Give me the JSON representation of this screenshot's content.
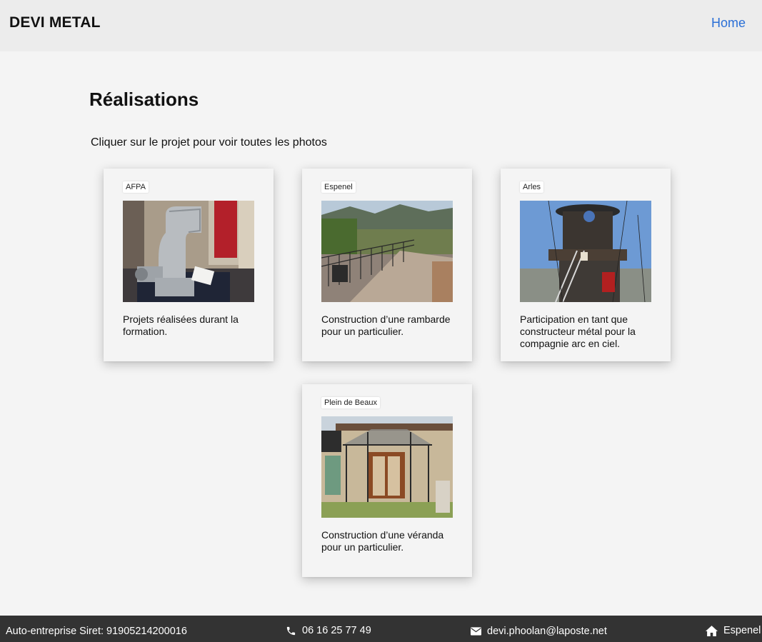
{
  "header": {
    "brand": "DEVI METAL",
    "nav_home": "Home"
  },
  "main": {
    "title": "Réalisations",
    "intro": "Cliquer sur le projet pour voir toutes les photos",
    "projects": [
      {
        "tag": "AFPA",
        "description": "Projets réalisées durant la formation.",
        "photo": "stainless-steel-elbow-pipe"
      },
      {
        "tag": "Espenel",
        "description": "Construction d’une rambarde pour un particulier.",
        "photo": "terrace-railing-mountains"
      },
      {
        "tag": "Arles",
        "description": "Participation en tant que constructeur métal pour la compagnie arc en ciel.",
        "photo": "metal-tower-structure"
      },
      {
        "tag": "Plein de Beaux",
        "description": "Construction d’une véranda pour un particulier.",
        "photo": "veranda-stone-house"
      }
    ]
  },
  "footer": {
    "siret": "Auto-entreprise Siret: 91905214200016",
    "phone": "06 16 25 77 49",
    "email": "devi.phoolan@laposte.net",
    "location": "Espenel",
    "icons": [
      "phone-icon",
      "envelope-icon",
      "home-icon"
    ]
  },
  "colors": {
    "header_bg": "#ececec",
    "page_bg": "#f4f4f4",
    "link": "#2a6fd6",
    "footer_bg": "#333333"
  }
}
